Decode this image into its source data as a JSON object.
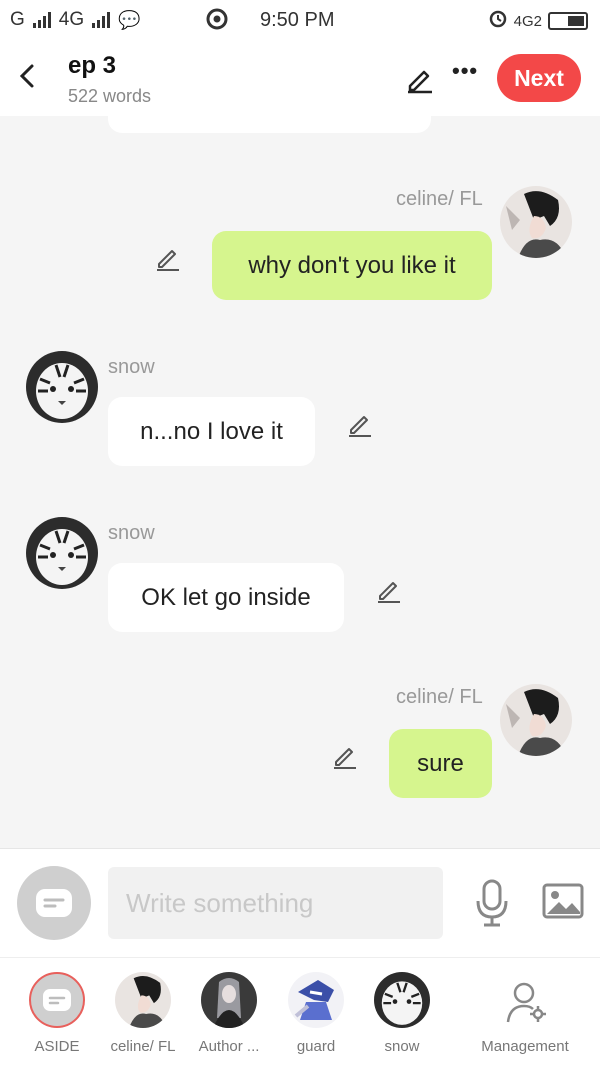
{
  "status_bar": {
    "carrier_left": "G",
    "network": "4G",
    "time": "9:50 PM",
    "network_right": "4G2"
  },
  "header": {
    "title": "ep 3",
    "word_count": "522 words",
    "next_label": "Next"
  },
  "messages": [
    {
      "sender": "celine/ FL",
      "text": "why don't you like it",
      "direction": "out"
    },
    {
      "sender": "snow",
      "text": "n...no I love it",
      "direction": "in"
    },
    {
      "sender": "snow",
      "text": "OK let go inside",
      "direction": "in"
    },
    {
      "sender": "celine/ FL",
      "text": "sure",
      "direction": "out"
    }
  ],
  "composer": {
    "placeholder": "Write something"
  },
  "tabs": [
    {
      "label": "ASIDE"
    },
    {
      "label": "celine/ FL"
    },
    {
      "label": "Author ..."
    },
    {
      "label": "guard"
    },
    {
      "label": "snow"
    },
    {
      "label": "Management"
    }
  ],
  "colors": {
    "accent_red": "#f34848",
    "outgoing_bubble": "#d6f58e",
    "background": "#f5f5f5"
  }
}
